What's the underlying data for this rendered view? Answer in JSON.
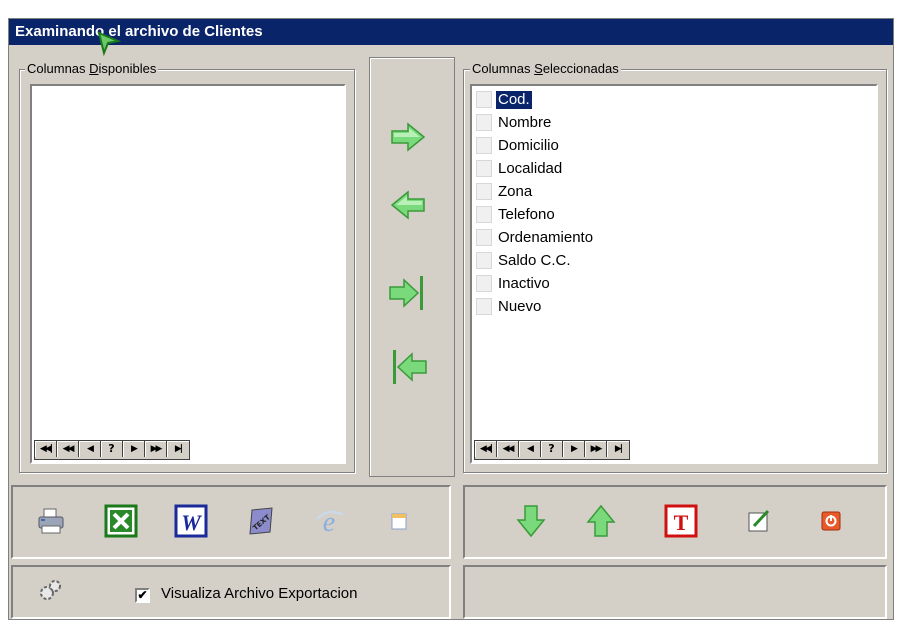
{
  "window": {
    "title": "Examinando el archivo de Clientes"
  },
  "available": {
    "legend_pre": "Columnas ",
    "legend_ul": "D",
    "legend_post": "isponibles",
    "items": []
  },
  "selected": {
    "legend_pre": "Columnas ",
    "legend_ul": "S",
    "legend_post": "eleccionadas",
    "items": [
      "Cod.",
      "Nombre",
      "Domicilio",
      "Localidad",
      "Zona",
      "Telefono",
      "Ordenamiento",
      "Saldo C.C.",
      "Inactivo",
      "Nuevo"
    ],
    "selected_index": 0
  },
  "navigator": {
    "buttons": [
      "◀◀|",
      "◀◀",
      "◀",
      "?",
      "▶",
      "▶▶",
      "▶|"
    ]
  },
  "move_buttons": {
    "add": "arrow-right-icon",
    "remove": "arrow-left-icon",
    "add_all": "arrow-right-all-icon",
    "remove_all": "arrow-left-all-icon"
  },
  "export_toolbar": {
    "icons": [
      "printer-icon",
      "excel-icon",
      "word-icon",
      "text-file-icon",
      "internet-explorer-icon",
      "clipboard-icon"
    ]
  },
  "order_toolbar": {
    "icons": [
      "move-down-icon",
      "move-up-icon",
      "title-icon",
      "edit-icon",
      "close-icon"
    ]
  },
  "options": {
    "visualize_label": "Visualiza Archivo Exportacion",
    "visualize_checked": true,
    "checkmark": "✔"
  },
  "colors": {
    "title_bg": "#0a246a",
    "face": "#d4d0c8",
    "arrow_green": "#66cc66"
  }
}
